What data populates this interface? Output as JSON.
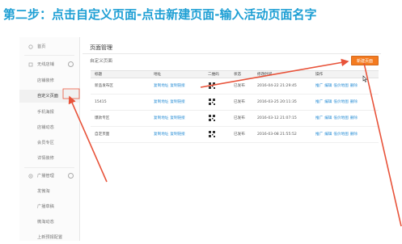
{
  "step_title": "第二步：点击自定义页面-点击新建页面-输入活动页面名字",
  "sidebar": {
    "items": [
      {
        "label": "首页",
        "type": "section"
      },
      {
        "label": "无线店铺",
        "type": "section"
      },
      {
        "label": "店铺装修",
        "type": "sub"
      },
      {
        "label": "自定义页面",
        "type": "sub",
        "active": true
      },
      {
        "label": "手机海报",
        "type": "sub"
      },
      {
        "label": "店铺动态",
        "type": "sub"
      },
      {
        "label": "会员专区",
        "type": "sub"
      },
      {
        "label": "详情装修",
        "type": "sub"
      },
      {
        "label": "广播管理",
        "type": "section"
      },
      {
        "label": "发微淘",
        "type": "sub"
      },
      {
        "label": "广播草稿",
        "type": "sub"
      },
      {
        "label": "微淘动态",
        "type": "sub"
      },
      {
        "label": "上新预报配置",
        "type": "sub"
      }
    ]
  },
  "main": {
    "title": "页面管理",
    "subtitle": "自定义页面",
    "new_button": "新建页面",
    "columns": [
      "标题",
      "地址",
      "二维码",
      "状态",
      "修改时间",
      "操作"
    ],
    "rows": [
      {
        "title": "新品发布区",
        "addr_copy": "复制地址",
        "addr_preview": "复制链接",
        "status": "已发布",
        "time": "2016-04-22 21:29:45",
        "actions": [
          "推广",
          "编辑",
          "低价地图",
          "删除"
        ]
      },
      {
        "title": "15415",
        "addr_copy": "复制地址",
        "addr_preview": "复制链接",
        "status": "已发布",
        "time": "2016-03-25 20:11:35",
        "actions": [
          "推广",
          "编辑",
          "低价地图",
          "删除"
        ]
      },
      {
        "title": "爆款专区",
        "addr_copy": "复制地址",
        "addr_preview": "复制链接",
        "status": "已发布",
        "time": "2016-03-12 21:07:15",
        "actions": [
          "推广",
          "编辑",
          "低价地图",
          "删除"
        ]
      },
      {
        "title": "自定页面",
        "addr_copy": "复制地址",
        "addr_preview": "复制链接",
        "status": "已发布",
        "time": "2016-03-08 21:55:52",
        "actions": [
          "推广",
          "编辑",
          "低价地图",
          "删除"
        ]
      }
    ]
  },
  "colors": {
    "title": "#1e9fd4",
    "arrow": "#e8533a",
    "button": "#f47b20",
    "link": "#2b8fd6"
  }
}
